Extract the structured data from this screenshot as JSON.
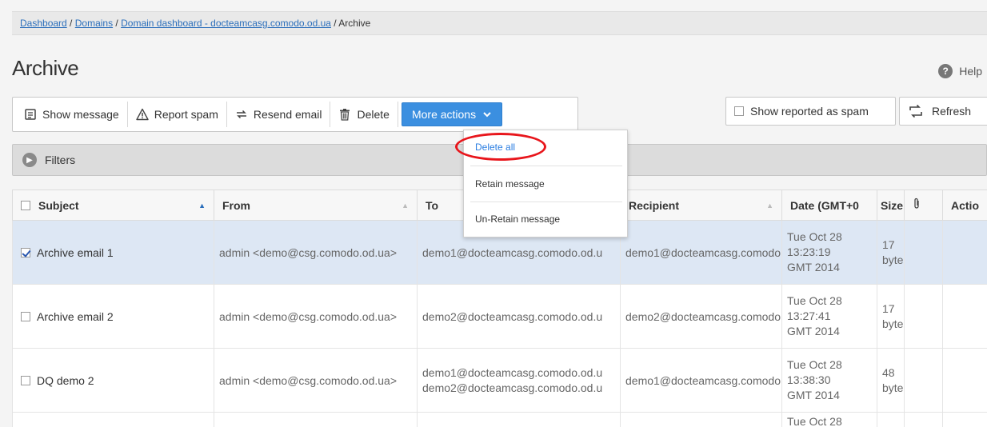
{
  "breadcrumb": {
    "links": [
      "Dashboard",
      "Domains",
      "Domain dashboard - docteamcasg.comodo.od.ua"
    ],
    "separator": " / ",
    "current": "Archive"
  },
  "page_title": "Archive",
  "help_label": "Help",
  "toolbar": {
    "show_message": "Show message",
    "report_spam": "Report spam",
    "resend_email": "Resend email",
    "delete": "Delete",
    "more_actions": "More actions"
  },
  "show_reported_spam": "Show reported as spam",
  "refresh": "Refresh",
  "filters_label": "Filters",
  "more_actions_menu": {
    "items": [
      "Delete all",
      "Retain message",
      "Un-Retain message"
    ]
  },
  "table": {
    "headers": {
      "subject": "Subject",
      "from": "From",
      "to": "To",
      "recipient": "Recipient",
      "date": "Date (GMT+0",
      "size": "Size",
      "actions": "Actio"
    },
    "rows": [
      {
        "subject": "Archive email 1",
        "checked": true,
        "from": "admin <demo@csg.comodo.od.ua>",
        "to": [
          "demo1@docteamcasg.comodo.od.u"
        ],
        "recipient": "demo1@docteamcasg.comodo",
        "date": [
          "Tue Oct 28",
          "13:23:19",
          "GMT 2014"
        ],
        "size": [
          "17",
          "bytes"
        ]
      },
      {
        "subject": "Archive email 2",
        "checked": false,
        "from": "admin <demo@csg.comodo.od.ua>",
        "to": [
          "demo2@docteamcasg.comodo.od.u"
        ],
        "recipient": "demo2@docteamcasg.comodo",
        "date": [
          "Tue Oct 28",
          "13:27:41",
          "GMT 2014"
        ],
        "size": [
          "17",
          "bytes"
        ]
      },
      {
        "subject": "DQ demo 2",
        "checked": false,
        "from": "admin <demo@csg.comodo.od.ua>",
        "to": [
          "demo1@docteamcasg.comodo.od.u",
          "demo2@docteamcasg.comodo.od.u"
        ],
        "recipient": "demo1@docteamcasg.comodo",
        "date": [
          "Tue Oct 28",
          "13:38:30",
          "GMT 2014"
        ],
        "size": [
          "48",
          "bytes"
        ]
      }
    ],
    "partial_row_date": "Tue Oct 28"
  },
  "colors": {
    "primary_button": "#3b8fe0",
    "selected_row": "#dde7f4",
    "link": "#2a6ebb",
    "highlight_ring": "#e8161c"
  }
}
